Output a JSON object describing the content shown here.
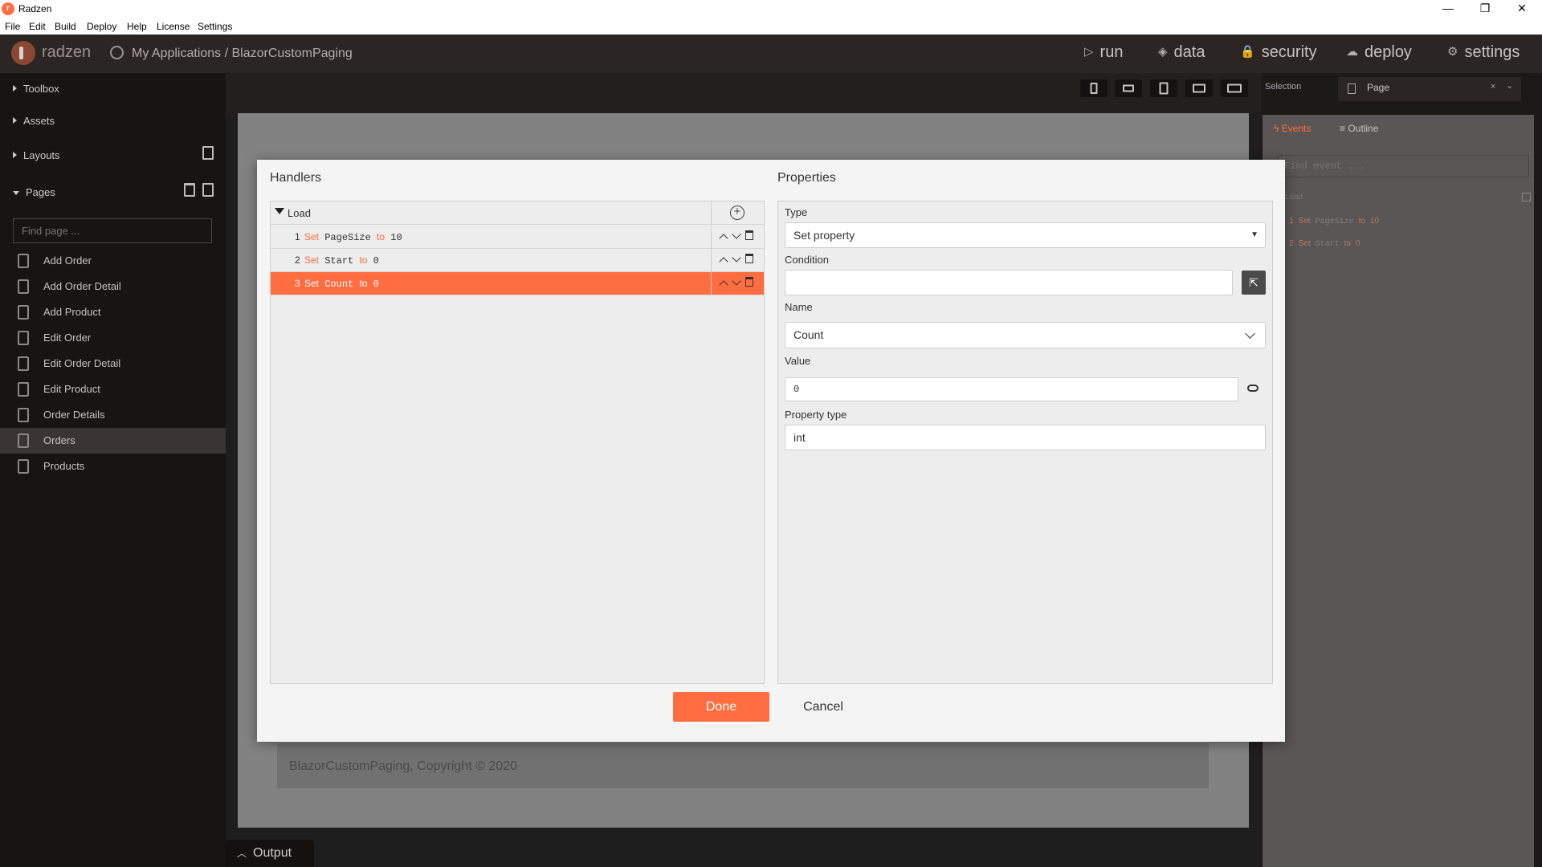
{
  "window": {
    "title": "Radzen",
    "logo_char": "r",
    "controls": {
      "minimize": "—",
      "maximize": "❐",
      "close": "✕"
    }
  },
  "menu": [
    "File",
    "Edit",
    "Build",
    "Deploy",
    "Help",
    "License",
    "Settings"
  ],
  "header": {
    "brand": "radzen",
    "breadcrumb": "My Applications / BlazorCustomPaging",
    "nav": [
      {
        "label": "run",
        "icon": "play-icon",
        "glyph": "▷"
      },
      {
        "label": "data",
        "icon": "layers-icon",
        "glyph": "◈"
      },
      {
        "label": "security",
        "icon": "lock-icon",
        "glyph": "🔒"
      },
      {
        "label": "deploy",
        "icon": "cloud-upload-icon",
        "glyph": "☁"
      },
      {
        "label": "settings",
        "icon": "gear-icon",
        "glyph": "⚙"
      }
    ]
  },
  "sidebar": {
    "sections": [
      "Toolbox",
      "Assets",
      "Layouts",
      "Pages"
    ],
    "find_placeholder": "Find page ...",
    "pages": [
      "Add Order",
      "Add Order Detail",
      "Add Product",
      "Edit Order",
      "Edit Order Detail",
      "Edit Product",
      "Order Details",
      "Orders",
      "Products"
    ],
    "active_page": "Orders"
  },
  "canvas": {
    "footer_text": "BlazorCustomPaging, Copyright © 2020",
    "output_label": "Output"
  },
  "right_panel": {
    "selection_label": "Selection",
    "selection_value": "Page",
    "tabs": {
      "events": "Events",
      "outline": "Outline"
    },
    "find_placeholder": "Find event ...",
    "event_name": "Load",
    "items": [
      {
        "num": "1",
        "action": "Set",
        "name": "PageSize",
        "to": "to",
        "value": "10"
      },
      {
        "num": "2",
        "action": "Set",
        "name": "Start",
        "to": "to",
        "value": "0"
      }
    ]
  },
  "dialog": {
    "handlers_title": "Handlers",
    "properties_title": "Properties",
    "event": "Load",
    "handlers": [
      {
        "num": "1",
        "action": "Set",
        "name": "PageSize",
        "to": "to",
        "value": "10"
      },
      {
        "num": "2",
        "action": "Set",
        "name": "Start",
        "to": "to",
        "value": "0"
      },
      {
        "num": "3",
        "action": "Set",
        "name": "Count",
        "to": "to",
        "value": "0"
      }
    ],
    "selected_handler": 3,
    "properties": {
      "type_label": "Type",
      "type_value": "Set property",
      "condition_label": "Condition",
      "condition_value": "",
      "name_label": "Name",
      "name_value": "Count",
      "value_label": "Value",
      "value_value": "0",
      "property_type_label": "Property type",
      "property_type_value": "int"
    },
    "done_label": "Done",
    "cancel_label": "Cancel"
  },
  "colors": {
    "accent": "#ff6d41",
    "header_bg": "#2b2523",
    "sidebar_bg": "#181412"
  }
}
